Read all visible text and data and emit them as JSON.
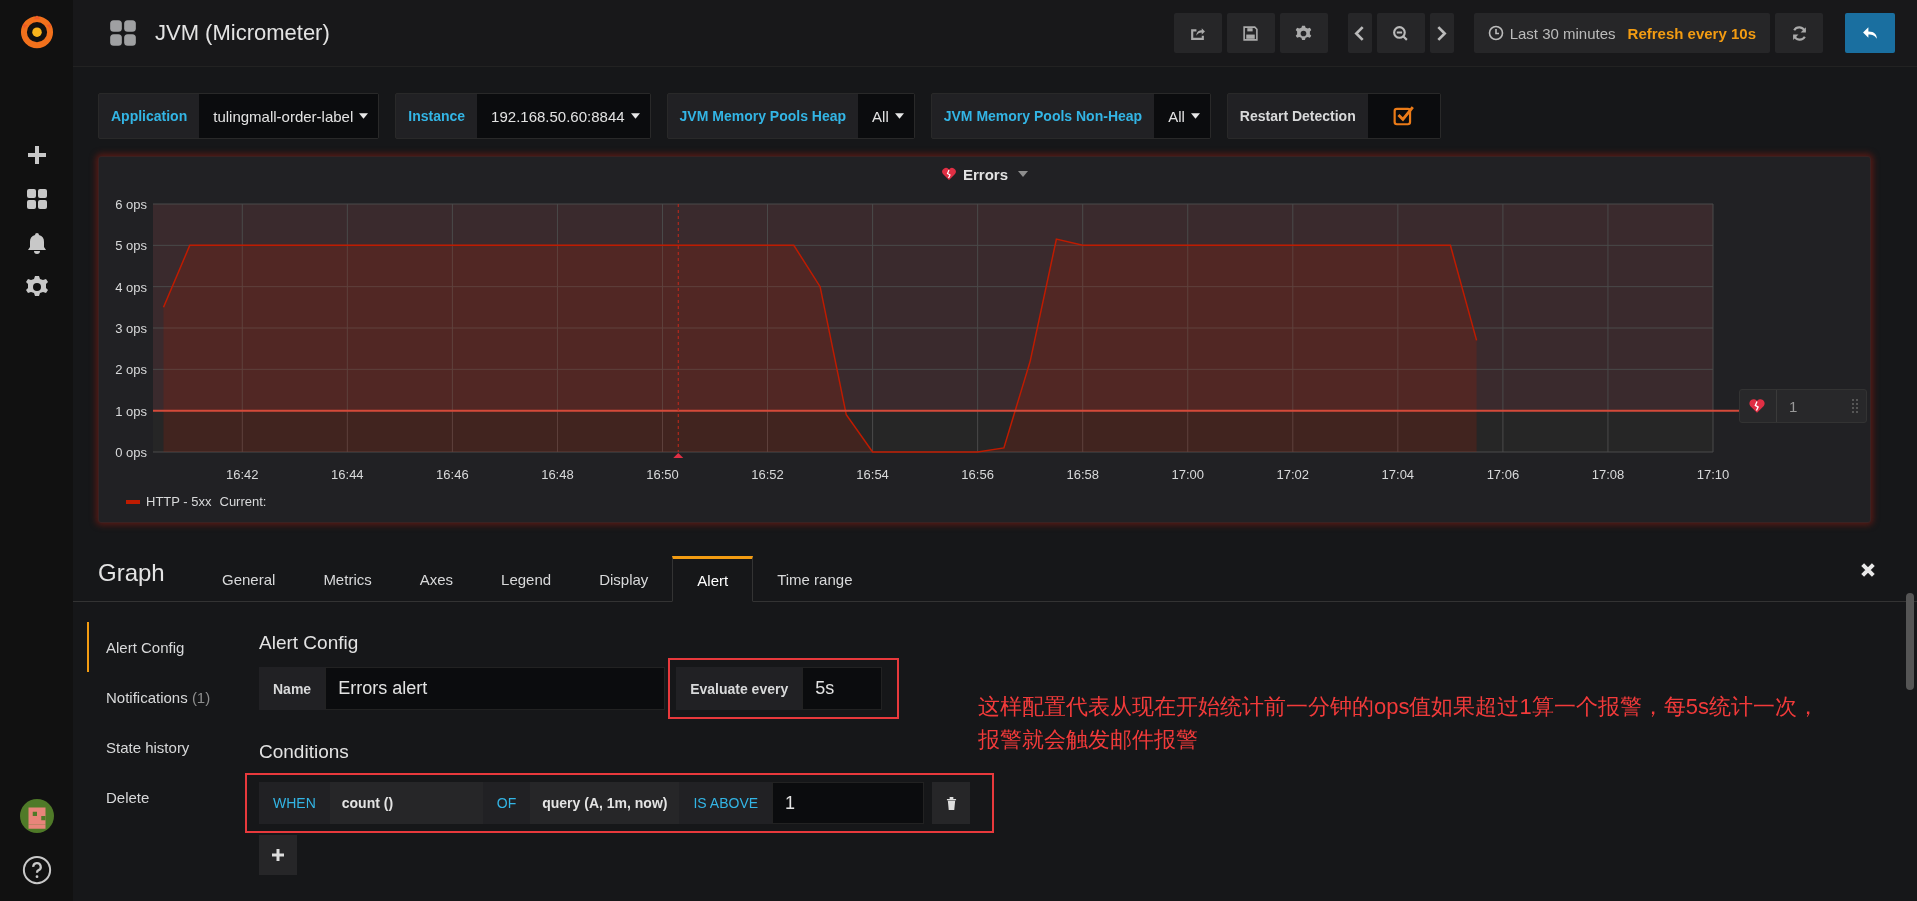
{
  "dashboard": {
    "title": "JVM (Micrometer)"
  },
  "toolbar": {
    "time_range": "Last 30 minutes",
    "refresh": "Refresh every 10s"
  },
  "variables": [
    {
      "kind": "dropdown",
      "label": "Application",
      "value": "tulingmall-order-label"
    },
    {
      "kind": "dropdown",
      "label": "Instance",
      "value": "192.168.50.60:8844"
    },
    {
      "kind": "dropdown",
      "label": "JVM Memory Pools Heap",
      "value": "All"
    },
    {
      "kind": "dropdown",
      "label": "JVM Memory Pools Non-Heap",
      "value": "All"
    },
    {
      "kind": "checkbox",
      "label": "Restart Detection",
      "checked": true
    }
  ],
  "panel": {
    "title": "Errors",
    "threshold_value": "1",
    "legend": [
      {
        "current": "Current:"
      }
    ],
    "chart_data": {
      "type": "area",
      "categories": [
        null,
        null,
        null,
        "16:42",
        null,
        null,
        null,
        "16:44",
        null,
        null,
        null,
        "16:46",
        null,
        null,
        null,
        "16:48",
        null,
        null,
        null,
        "16:50",
        null,
        null,
        null,
        "16:52",
        null,
        null,
        null,
        "16:54",
        null,
        null,
        null,
        "16:56",
        null,
        null,
        null,
        "16:58",
        null,
        null,
        null,
        "17:00",
        null,
        null,
        null,
        "17:02",
        null,
        null,
        null,
        "17:04",
        null,
        null,
        null,
        "17:06",
        null,
        null,
        null,
        "17:08",
        null,
        null,
        null,
        "17:10"
      ],
      "series": [
        {
          "name": "HTTP - 5xx",
          "color": "#bf1b00",
          "values": [
            3.5,
            5,
            5,
            5,
            5,
            5,
            5,
            5,
            5,
            5,
            5,
            5,
            5,
            5,
            5,
            5,
            5,
            5,
            5,
            5,
            5,
            5,
            5,
            5,
            5,
            4,
            0.9,
            0,
            0,
            0,
            0,
            0,
            0.1,
            2.2,
            5.15,
            5,
            5,
            5,
            5,
            5,
            5,
            5,
            5,
            5,
            5,
            5,
            5,
            5,
            5,
            5,
            2.7,
            null,
            null,
            null,
            null,
            null,
            null,
            null,
            null,
            null
          ]
        }
      ],
      "ylim": [
        0,
        6
      ],
      "yticks": [
        {
          "value": 0,
          "label": "0 ops"
        },
        {
          "value": 1,
          "label": "1 ops"
        },
        {
          "value": 2,
          "label": "2 ops"
        },
        {
          "value": 3,
          "label": "3 ops"
        },
        {
          "value": 4,
          "label": "4 ops"
        },
        {
          "value": 5,
          "label": "5 ops"
        },
        {
          "value": 6,
          "label": "6 ops"
        }
      ],
      "grid": true,
      "ref_lines": [
        {
          "axis": "y",
          "value": 1
        }
      ]
    }
  },
  "editor": {
    "title": "Graph",
    "tabs": [
      {
        "label": "General",
        "selected": false
      },
      {
        "label": "Metrics",
        "selected": false
      },
      {
        "label": "Axes",
        "selected": false
      },
      {
        "label": "Legend",
        "selected": false
      },
      {
        "label": "Display",
        "selected": false
      },
      {
        "label": "Alert",
        "selected": true
      },
      {
        "label": "Time range",
        "selected": false
      }
    ],
    "side_items": [
      {
        "label": "Alert Config",
        "selected": true
      },
      {
        "label": "Notifications",
        "count": "(1)",
        "selected": false
      },
      {
        "label": "State history",
        "selected": false
      },
      {
        "label": "Delete",
        "selected": false
      }
    ],
    "section_title": "Alert Config",
    "name_label": "Name",
    "name_value": "Errors alert",
    "evaluate_label": "Evaluate every",
    "evaluate_value": "5s",
    "conditions_title": "Conditions",
    "condition": {
      "when": "WHEN",
      "reducer": "count ()",
      "of": "OF",
      "query": "query (A, 1m, now)",
      "evaluator": "IS ABOVE",
      "value": "1"
    }
  },
  "note": "这样配置代表从现在开始统计前一分钟的ops值如果超过1算一个报警，每5s统计一次，报警就会触发邮件报警"
}
